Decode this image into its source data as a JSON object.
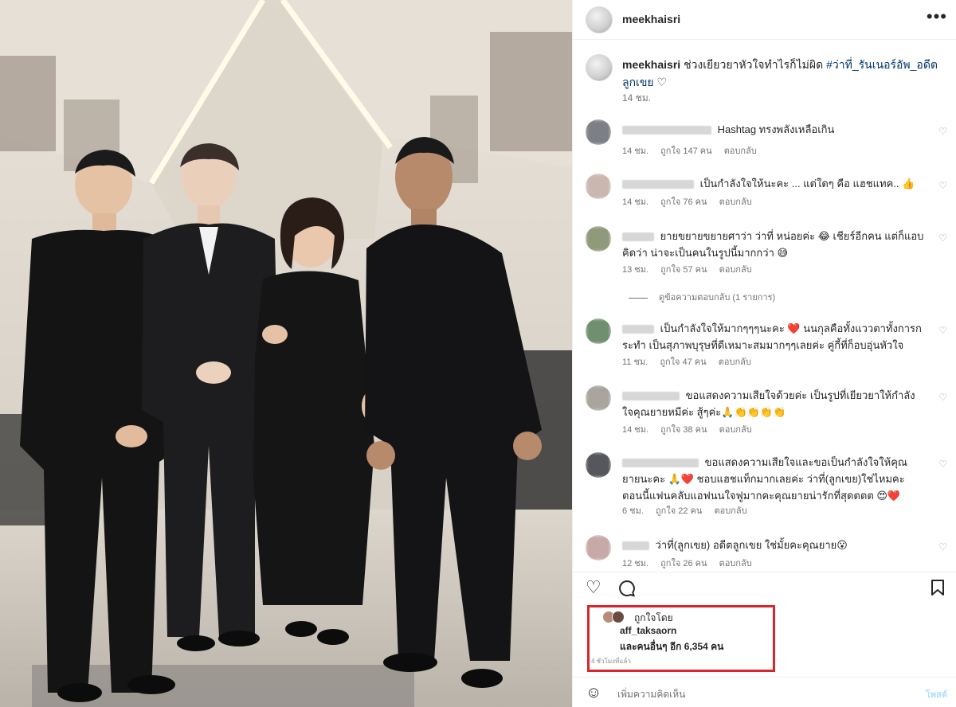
{
  "header": {
    "username": "meekhaisri"
  },
  "caption": {
    "username": "meekhaisri",
    "text": "ช่วงเยียวยาหัวใจทำไรก็ไม่ผิด",
    "hashtag": "#ว่าที่_รันเนอร์อัพ_อดีตลูกเขย",
    "time": "14 ชม."
  },
  "comments": [
    {
      "text": "Hashtag ทรงพลังเหลือเกิน",
      "time": "14 ชม.",
      "likes": "ถูกใจ 147 คน",
      "reply": "ตอบกลับ"
    },
    {
      "text": "เป็นกำลังใจให้นะคะ ... แต่ใดๆ คือ แฮชแทค.. 👍",
      "time": "14 ชม.",
      "likes": "ถูกใจ 76 คน",
      "reply": "ตอบกลับ"
    },
    {
      "text": "ยายขยายขยายศาว่า ว่าที่ หน่อยค่ะ 😂 เชียร์อีกคน แต่ก็แอบคิดว่า น่าจะเป็นคนในรูปนี้มากกว่า 😅",
      "time": "13 ชม.",
      "likes": "ถูกใจ 57 คน",
      "reply": "ตอบกลับ"
    },
    {
      "text": "เป็นกำลังใจให้มากๆๆๆนะคะ ❤️ นนกุลคือทั้งแววตาทั้งการกระทำ เป็นสุภาพบุรุษที่ดีเหมาะสมมากๆๆเลยค่ะ คู่กี้ที่ก็อบอุ่นหัวใจ",
      "time": "11 ชม.",
      "likes": "ถูกใจ 47 คน",
      "reply": "ตอบกลับ"
    },
    {
      "text": "ขอแสดงความเสียใจด้วยค่ะ เป็นรูปที่เยียวยาให้กำลังใจคุณยายหมีค่ะ สู้ๆค่ะ🙏👏👏👏👏",
      "time": "14 ชม.",
      "likes": "ถูกใจ 38 คน",
      "reply": "ตอบกลับ"
    },
    {
      "text": "ขอแสดงความเสียใจและขอเป็นกำลังใจให้คุณยายนะคะ 🙏❤️ ชอบแฮชแท็กมากเลยค่ะ ว่าที่(ลูกเขย)ใช่ไหมคะ ตอนนี้แฟนคลับแอฟนนใจฟูมากคะคุณยายน่ารักที่สุดตตต 😍❤️",
      "time": "6 ชม.",
      "likes": "ถูกใจ 22 คน",
      "reply": "ตอบกลับ"
    },
    {
      "text": "ว่าที่(ลูกเขย) อดีตลูกเขย ใช่มั้ยคะคุณยาย😮",
      "time": "12 ชม.",
      "likes": "ถูกใจ 26 คน",
      "reply": "ตอบกลับ"
    }
  ],
  "view_replies": "ดูข้อความตอบกลับ (1 รายการ)",
  "likes": {
    "label": "ถูกใจโดย",
    "user": "aff_taksaorn",
    "others": "และคนอื่นๆ อีก 6,354 คน",
    "when": "4 ชั่วโมงที่แล้ว"
  },
  "add_comment": {
    "placeholder": "เพิ่มความคิดเห็น",
    "post": "โพสต์"
  },
  "icons": {
    "more": "more-icon",
    "heart": "heart-icon",
    "comment": "comment-icon",
    "bookmark": "bookmark-icon",
    "emoji": "emoji-icon"
  },
  "colors": {
    "highlight_box": "#d7262c",
    "hashtag": "#00376b",
    "meta": "#737373"
  }
}
